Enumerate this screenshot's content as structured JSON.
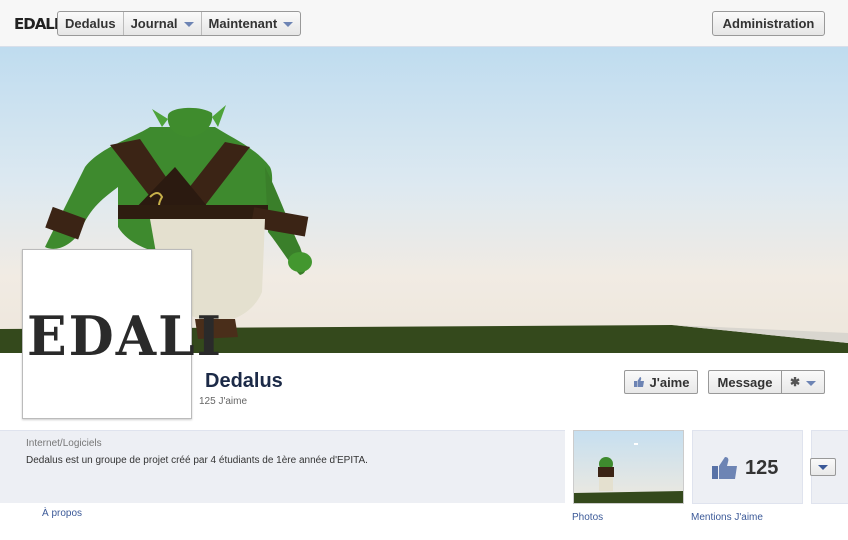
{
  "topbar": {
    "logo": "EDALI",
    "nav": [
      {
        "label": "Dedalus"
      },
      {
        "label": "Journal"
      },
      {
        "label": "Maintenant"
      }
    ],
    "admin_label": "Administration"
  },
  "profile": {
    "avatar_text": "EDALI",
    "name": "Dedalus",
    "likes_line": "125 J'aime"
  },
  "actions": {
    "like_label": "J'aime",
    "message_label": "Message"
  },
  "about": {
    "category": "Internet/Logiciels",
    "description": "Dedalus est un groupe de projet créé par 4 étudiants de 1ère année d'EPITA.",
    "tab_label": "À propos"
  },
  "apps": {
    "photos_label": "Photos",
    "likes_count": "125",
    "likes_label": "Mentions J'aime"
  },
  "colors": {
    "link": "#3b5998",
    "accent": "#6d84b4",
    "title": "#1c2a47"
  }
}
